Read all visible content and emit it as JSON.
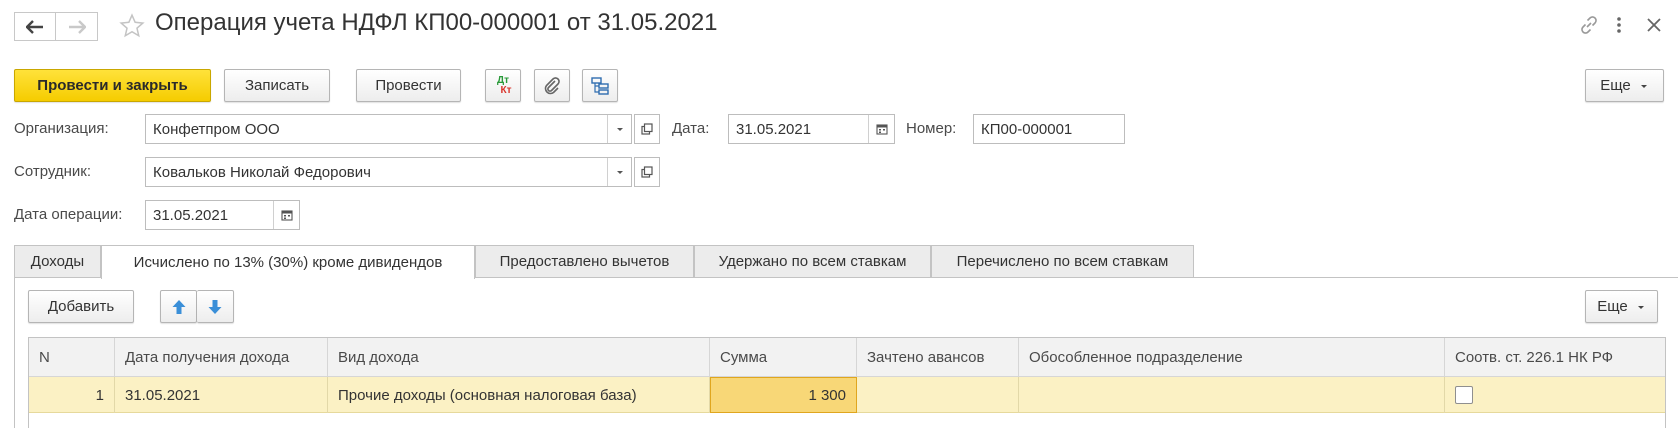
{
  "header": {
    "title": "Операция учета НДФЛ КП00-000001 от 31.05.2021"
  },
  "toolbar": {
    "post_close": "Провести и закрыть",
    "save": "Записать",
    "post": "Провести",
    "dtkt_top": "Дт",
    "dtkt_bottom": "Кт",
    "more": "Еще"
  },
  "form": {
    "org_label": "Организация:",
    "org_value": "Конфетпром ООО",
    "date_label": "Дата:",
    "date_value": "31.05.2021",
    "number_label": "Номер:",
    "number_value": "КП00-000001",
    "employee_label": "Сотрудник:",
    "employee_value": "Ковальков Николай Федорович",
    "op_date_label": "Дата операции:",
    "op_date_value": "31.05.2021"
  },
  "tabs": [
    {
      "label": "Доходы"
    },
    {
      "label": "Исчислено по 13% (30%) кроме дивидендов"
    },
    {
      "label": "Предоставлено вычетов"
    },
    {
      "label": "Удержано по всем ставкам"
    },
    {
      "label": "Перечислено по всем ставкам"
    }
  ],
  "panel": {
    "add": "Добавить",
    "more": "Еще"
  },
  "table": {
    "columns": [
      "N",
      "Дата получения дохода",
      "Вид дохода",
      "Сумма",
      "Зачтено авансов",
      "Обособленное подразделение",
      "Соотв. ст. 226.1 НК РФ"
    ],
    "rows": [
      {
        "n": "1",
        "date": "31.05.2021",
        "kind": "Прочие доходы (основная налоговая база)",
        "sum": "1 300",
        "advances": "",
        "division": "",
        "art226": false
      }
    ]
  },
  "colors": {
    "primary": "#f5cc00",
    "row_highlight": "#fbf1c4",
    "selected_cell": "#f8d777",
    "arrow_blue": "#3a8fd8"
  },
  "icons": [
    "back-arrow-icon",
    "forward-arrow-icon",
    "star-icon",
    "link-icon",
    "more-vertical-icon",
    "close-icon",
    "dtkt-icon",
    "paperclip-icon",
    "structure-icon",
    "dropdown-icon",
    "open-icon",
    "calendar-icon",
    "arrow-up-icon",
    "arrow-down-icon"
  ]
}
